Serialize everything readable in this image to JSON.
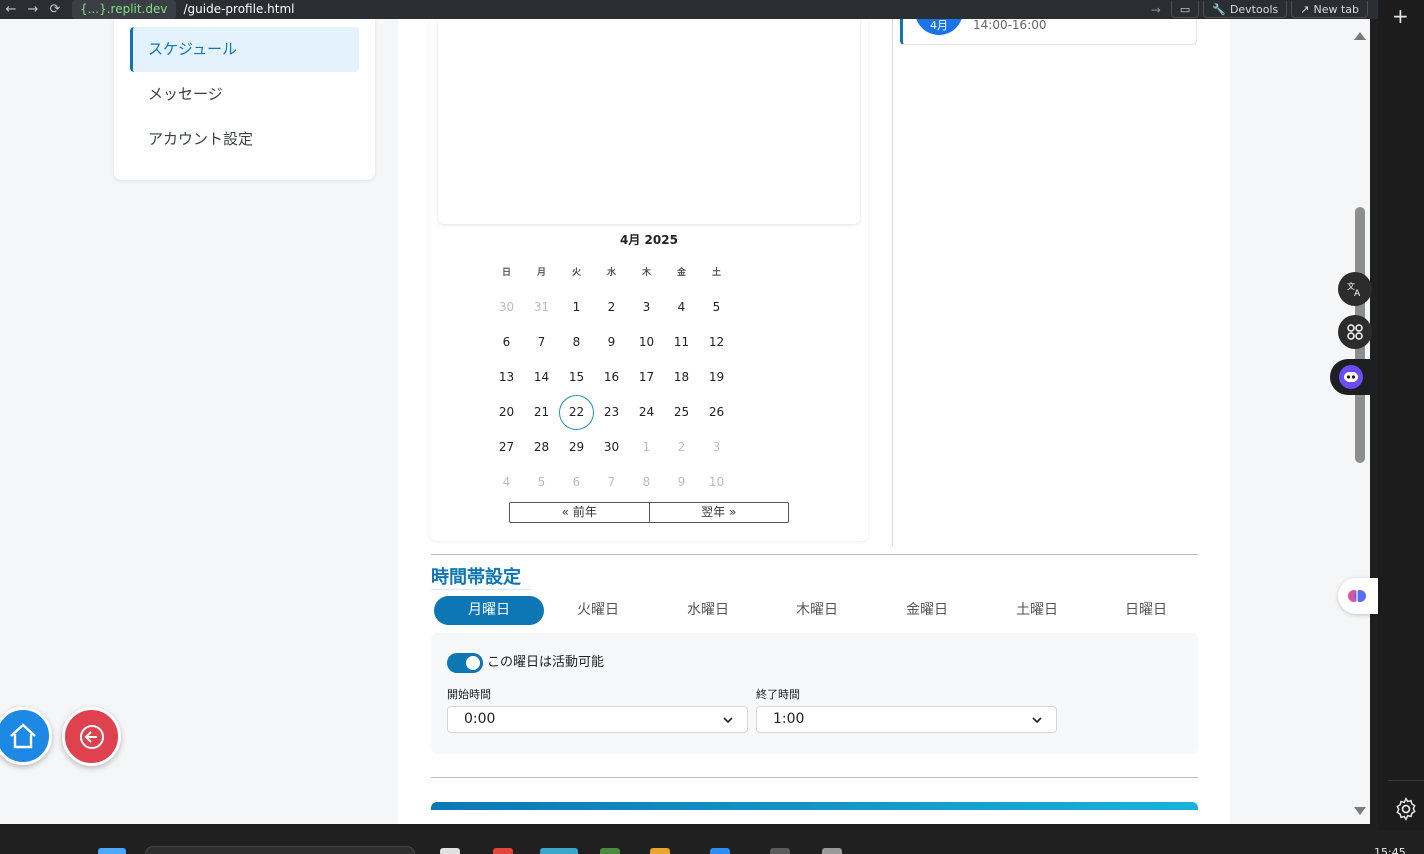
{
  "browser": {
    "url_host": "{...}.replit.dev",
    "url_path": "/guide-profile.html",
    "devtools_label": "Devtools",
    "new_tab_label": "New tab"
  },
  "sidebar": {
    "items": [
      {
        "label": "スケジュール",
        "active": true
      },
      {
        "label": "メッセージ",
        "active": false
      },
      {
        "label": "アカウント設定",
        "active": false
      }
    ]
  },
  "calendar": {
    "month_title": "4月 2025",
    "weekdays": [
      "日",
      "月",
      "火",
      "水",
      "木",
      "金",
      "土"
    ],
    "weeks": [
      [
        {
          "d": "30",
          "m": true
        },
        {
          "d": "31",
          "m": true
        },
        {
          "d": "1"
        },
        {
          "d": "2"
        },
        {
          "d": "3"
        },
        {
          "d": "4"
        },
        {
          "d": "5"
        }
      ],
      [
        {
          "d": "6"
        },
        {
          "d": "7"
        },
        {
          "d": "8"
        },
        {
          "d": "9"
        },
        {
          "d": "10"
        },
        {
          "d": "11"
        },
        {
          "d": "12"
        }
      ],
      [
        {
          "d": "13"
        },
        {
          "d": "14"
        },
        {
          "d": "15"
        },
        {
          "d": "16"
        },
        {
          "d": "17"
        },
        {
          "d": "18"
        },
        {
          "d": "19"
        }
      ],
      [
        {
          "d": "20"
        },
        {
          "d": "21"
        },
        {
          "d": "22",
          "today": true
        },
        {
          "d": "23"
        },
        {
          "d": "24"
        },
        {
          "d": "25"
        },
        {
          "d": "26"
        }
      ],
      [
        {
          "d": "27"
        },
        {
          "d": "28"
        },
        {
          "d": "29"
        },
        {
          "d": "30"
        },
        {
          "d": "1",
          "m": true
        },
        {
          "d": "2",
          "m": true
        },
        {
          "d": "3",
          "m": true
        }
      ],
      [
        {
          "d": "4",
          "m": true
        },
        {
          "d": "5",
          "m": true
        },
        {
          "d": "6",
          "m": true
        },
        {
          "d": "7",
          "m": true
        },
        {
          "d": "8",
          "m": true
        },
        {
          "d": "9",
          "m": true
        },
        {
          "d": "10",
          "m": true
        }
      ]
    ],
    "prev_year_label": "« 前年",
    "next_year_label": "翌年 »"
  },
  "event": {
    "month_badge": "4月",
    "time": "14:00-16:00"
  },
  "time_settings": {
    "title": "時間帯設定",
    "tabs": [
      {
        "label": "月曜日",
        "active": true
      },
      {
        "label": "火曜日",
        "active": false
      },
      {
        "label": "水曜日",
        "active": false
      },
      {
        "label": "木曜日",
        "active": false
      },
      {
        "label": "金曜日",
        "active": false
      },
      {
        "label": "土曜日",
        "active": false
      },
      {
        "label": "日曜日",
        "active": false
      }
    ],
    "available_label": "この曜日は活動可能",
    "available": true,
    "start_label": "開始時間",
    "start_value": "0:00",
    "end_label": "終了時間",
    "end_value": "1:00"
  },
  "taskbar": {
    "clock": "15:45"
  },
  "colors": {
    "accent": "#0d77b5",
    "home_button": "#1e88e5",
    "back_button": "#e0414f"
  }
}
